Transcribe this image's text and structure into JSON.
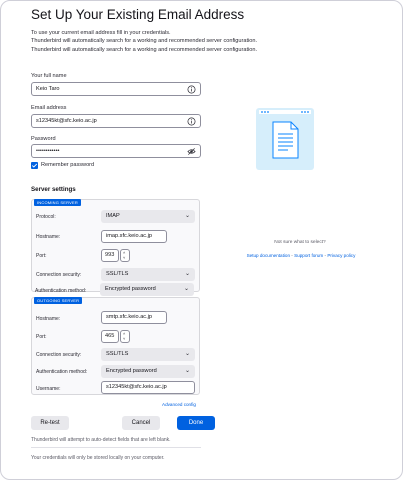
{
  "header": {
    "title": "Set Up Your Existing Email Address",
    "intro_lines": [
      "To use your current email address fill in your credentials.",
      "Thunderbird will automatically search for a working and recommended server configuration.",
      "Thunderbird will automatically search for a working and recommended server configuration."
    ]
  },
  "form": {
    "full_name_label": "Your full name",
    "full_name_value": "Keio Taro",
    "email_label": "Email address",
    "email_value": "s12345kt@sfc.keio.ac.jp",
    "password_label": "Password",
    "password_value": "••••••••••••",
    "remember_label": "Remember password",
    "remember_checked": true
  },
  "server_settings": {
    "title": "Server settings",
    "incoming": {
      "tag": "INCOMING SERVER",
      "protocol_label": "Protocol:",
      "protocol_value": "IMAP",
      "hostname_label": "Hostname:",
      "hostname_value": "imap.sfc.keio.ac.jp",
      "port_label": "Port:",
      "port_value": "993",
      "security_label": "Connection security:",
      "security_value": "SSL/TLS",
      "auth_label": "Authentication method:",
      "auth_value": "Encrypted password"
    },
    "outgoing": {
      "tag": "OUTGOING SERVER",
      "hostname_label": "Hostname:",
      "hostname_value": "smtp.sfc.keio.ac.jp",
      "port_label": "Port:",
      "port_value": "465",
      "security_label": "Connection security:",
      "security_value": "SSL/TLS",
      "auth_label": "Authentication method:",
      "auth_value": "Encrypted password",
      "username_label": "Username:",
      "username_value": "s12345kt@sfc.keio.ac.jp"
    },
    "advanced_label": "Advanced config"
  },
  "actions": {
    "retest_label": "Re-test",
    "cancel_label": "Cancel",
    "done_label": "Done"
  },
  "footer": {
    "note_1": "Thunderbird will attempt to auto-detect fields that are left blank.",
    "note_2": "Your credentials will only be stored locally on your computer."
  },
  "help": {
    "question": "Not sure what to select?",
    "setup_docs": "Setup documentation",
    "support_forum": "Support forum",
    "privacy_policy": "Privacy policy",
    "separator": " - "
  },
  "icons": {
    "info": "info-icon",
    "password_toggle": "eye-slash-icon",
    "checkbox": "checkmark-icon",
    "dropdown": "chevron-down-icon",
    "spinner": "spinner-arrows-icon",
    "illustration": "document-browser-illustration"
  },
  "colors": {
    "accent": "#0061e0",
    "text": "#15141a",
    "muted": "#5b5b66",
    "button_secondary": "#e8e8ec",
    "illustration_bg": "#d6eefb"
  }
}
